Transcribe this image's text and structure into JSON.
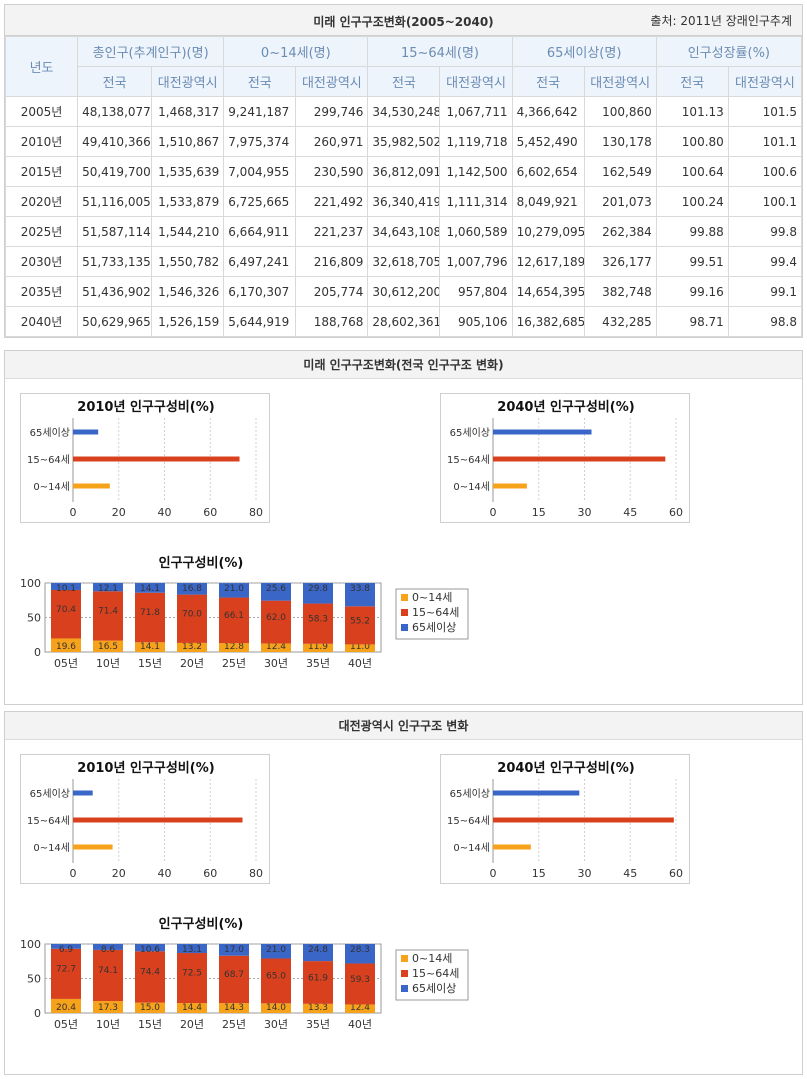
{
  "table": {
    "title": "미래 인구구조변화(2005~2040)",
    "source": "출처: 2011년 장래인구추계",
    "year_header": "년도",
    "groups": [
      "총인구(추계인구)(명)",
      "0~14세(명)",
      "15~64세(명)",
      "65세이상(명)",
      "인구성장률(%)"
    ],
    "sub": [
      "전국",
      "대전광역시"
    ],
    "rows": [
      [
        "2005년",
        "48,138,077",
        "1,468,317",
        "9,241,187",
        "299,746",
        "34,530,248",
        "1,067,711",
        "4,366,642",
        "100,860",
        "101.13",
        "101.5"
      ],
      [
        "2010년",
        "49,410,366",
        "1,510,867",
        "7,975,374",
        "260,971",
        "35,982,502",
        "1,119,718",
        "5,452,490",
        "130,178",
        "100.80",
        "101.1"
      ],
      [
        "2015년",
        "50,419,700",
        "1,535,639",
        "7,004,955",
        "230,590",
        "36,812,091",
        "1,142,500",
        "6,602,654",
        "162,549",
        "100.64",
        "100.6"
      ],
      [
        "2020년",
        "51,116,005",
        "1,533,879",
        "6,725,665",
        "221,492",
        "36,340,419",
        "1,111,314",
        "8,049,921",
        "201,073",
        "100.24",
        "100.1"
      ],
      [
        "2025년",
        "51,587,114",
        "1,544,210",
        "6,664,911",
        "221,237",
        "34,643,108",
        "1,060,589",
        "10,279,095",
        "262,384",
        "99.88",
        "99.8"
      ],
      [
        "2030년",
        "51,733,135",
        "1,550,782",
        "6,497,241",
        "216,809",
        "32,618,705",
        "1,007,796",
        "12,617,189",
        "326,177",
        "99.51",
        "99.4"
      ],
      [
        "2035년",
        "51,436,902",
        "1,546,326",
        "6,170,307",
        "205,774",
        "30,612,200",
        "957,804",
        "14,654,395",
        "382,748",
        "99.16",
        "99.1"
      ],
      [
        "2040년",
        "50,629,965",
        "1,526,159",
        "5,644,919",
        "188,768",
        "28,602,361",
        "905,106",
        "16,382,685",
        "432,285",
        "98.71",
        "98.8"
      ]
    ]
  },
  "colors": {
    "age0_14": "#f7a21b",
    "age15_64": "#d9401d",
    "age65": "#3a66c8"
  },
  "chart_data": [
    {
      "id": "nat2010",
      "type": "bar",
      "orientation": "horizontal",
      "title": "2010년 인구구성비(%)",
      "categories": [
        "65세이상",
        "15~64세",
        "0~14세"
      ],
      "values": [
        11.0,
        72.8,
        16.1
      ],
      "xticks": [
        "0",
        "20",
        "40",
        "60",
        "80"
      ],
      "xlim": [
        0,
        80
      ]
    },
    {
      "id": "nat2040",
      "type": "bar",
      "orientation": "horizontal",
      "title": "2040년 인구구성비(%)",
      "categories": [
        "65세이상",
        "15~64세",
        "0~14세"
      ],
      "values": [
        32.3,
        56.5,
        11.1
      ],
      "xticks": [
        "0",
        "15",
        "30",
        "45",
        "60"
      ],
      "xlim": [
        0,
        60
      ]
    },
    {
      "id": "natStack",
      "type": "bar",
      "stacked": true,
      "title": "인구구성비(%)",
      "categories": [
        "05년",
        "10년",
        "15년",
        "20년",
        "25년",
        "30년",
        "35년",
        "40년"
      ],
      "yticks": [
        "0",
        "50",
        "100"
      ],
      "ylim": [
        0,
        100
      ],
      "series": [
        {
          "name": "0~14세",
          "values": [
            19.6,
            16.5,
            14.1,
            13.2,
            12.8,
            12.4,
            11.9,
            11.0
          ]
        },
        {
          "name": "15~64세",
          "values": [
            70.4,
            71.4,
            71.8,
            70.0,
            66.1,
            62.0,
            58.3,
            55.2
          ]
        },
        {
          "name": "65세이상",
          "values": [
            10.1,
            12.1,
            14.1,
            16.8,
            21.0,
            25.6,
            29.8,
            33.8
          ]
        }
      ]
    },
    {
      "id": "dj2010",
      "type": "bar",
      "orientation": "horizontal",
      "title": "2010년 인구구성비(%)",
      "categories": [
        "65세이상",
        "15~64세",
        "0~14세"
      ],
      "values": [
        8.6,
        74.1,
        17.3
      ],
      "xticks": [
        "0",
        "20",
        "40",
        "60",
        "80"
      ],
      "xlim": [
        0,
        80
      ]
    },
    {
      "id": "dj2040",
      "type": "bar",
      "orientation": "horizontal",
      "title": "2040년 인구구성비(%)",
      "categories": [
        "65세이상",
        "15~64세",
        "0~14세"
      ],
      "values": [
        28.3,
        59.3,
        12.4
      ],
      "xticks": [
        "0",
        "15",
        "30",
        "45",
        "60"
      ],
      "xlim": [
        0,
        60
      ]
    },
    {
      "id": "djStack",
      "type": "bar",
      "stacked": true,
      "title": "인구구성비(%)",
      "categories": [
        "05년",
        "10년",
        "15년",
        "20년",
        "25년",
        "30년",
        "35년",
        "40년"
      ],
      "yticks": [
        "0",
        "50",
        "100"
      ],
      "ylim": [
        0,
        100
      ],
      "series": [
        {
          "name": "0~14세",
          "values": [
            20.4,
            17.3,
            15.0,
            14.4,
            14.3,
            14.0,
            13.3,
            12.4
          ]
        },
        {
          "name": "15~64세",
          "values": [
            72.7,
            74.1,
            74.4,
            72.5,
            68.7,
            65.0,
            61.9,
            59.3
          ]
        },
        {
          "name": "65세이상",
          "values": [
            6.9,
            8.6,
            10.6,
            13.1,
            17.0,
            21.0,
            24.8,
            28.3
          ]
        }
      ]
    }
  ],
  "sections": {
    "national": "미래 인구구조변화(전국 인구구조 변화)",
    "daejeon": "대전광역시 인구구조 변화"
  }
}
